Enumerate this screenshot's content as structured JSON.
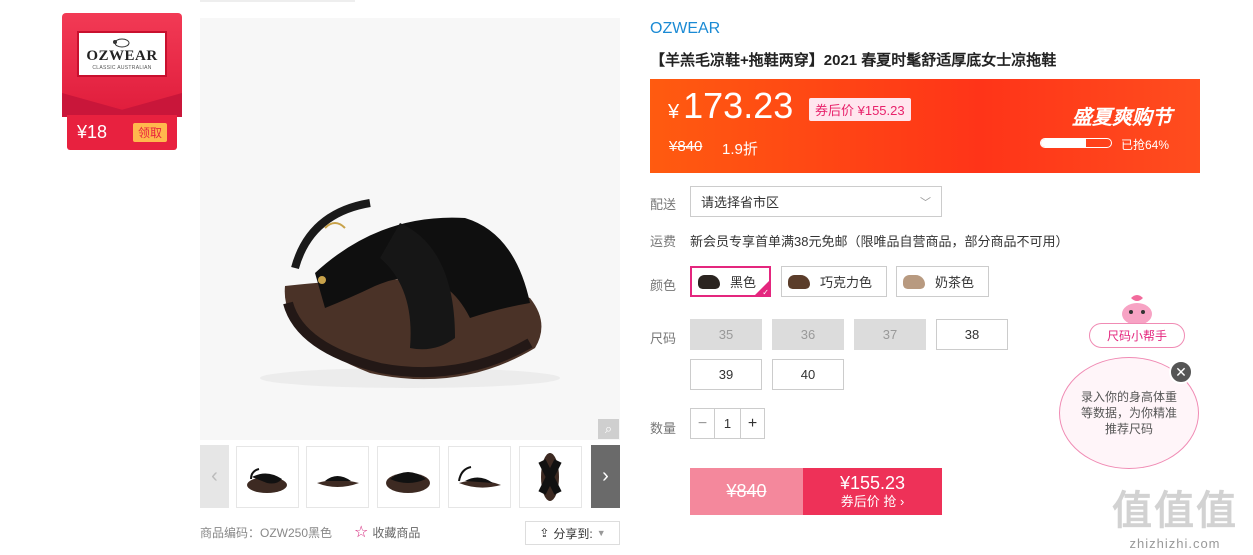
{
  "coupon": {
    "brand": "OZWEAR",
    "brand_sub": "CLASSIC AUSTRALIAN",
    "amount": "¥18",
    "claim": "领取"
  },
  "gallery": {
    "product_code_label": "商品编码：OZW250黑色",
    "favorite_label": "收藏商品",
    "share_label": "分享到:"
  },
  "product": {
    "brand": "OZWEAR",
    "title": "【羊羔毛凉鞋+拖鞋两穿】2021 春夏时髦舒适厚底女士凉拖鞋"
  },
  "price": {
    "yen": "¥",
    "current": "173.23",
    "after_coupon": "券后价 ¥155.23",
    "original": "¥840",
    "discount": "1.9折",
    "promo": "盛夏爽购节",
    "sold_percent": 64,
    "sold_label": "已抢64%"
  },
  "delivery": {
    "label": "配送",
    "placeholder": "请选择省市区"
  },
  "shipping": {
    "label": "运费",
    "text": "新会员专享首单满38元免邮（限唯品自营商品，部分商品不可用）"
  },
  "colors": {
    "label": "颜色",
    "options": [
      {
        "name": "黑色",
        "selected": true,
        "swatch": "#2b2420"
      },
      {
        "name": "巧克力色",
        "selected": false,
        "swatch": "#5b3d2a"
      },
      {
        "name": "奶茶色",
        "selected": false,
        "swatch": "#b89a80"
      }
    ]
  },
  "sizes": {
    "label": "尺码",
    "options": [
      {
        "value": "35",
        "available": false
      },
      {
        "value": "36",
        "available": false
      },
      {
        "value": "37",
        "available": false
      },
      {
        "value": "38",
        "available": true
      },
      {
        "value": "39",
        "available": true
      },
      {
        "value": "40",
        "available": true
      }
    ]
  },
  "quantity": {
    "label": "数量",
    "minus": "−",
    "value": "1",
    "plus": "+"
  },
  "buy": {
    "original": "¥840",
    "price": "¥155.23",
    "label": "券后价 抢 ›"
  },
  "helper": {
    "tag": "尺码小帮手",
    "bubble": "录入你的身高体重等数据，为你精准推荐尺码",
    "close": "✕"
  },
  "watermark": {
    "logo": "值值值",
    "url": "zhizhizhi.com"
  },
  "colors_theme": {
    "accent": "#e4267e",
    "price_bar": "#ff3418",
    "brand_link": "#1a8ad4"
  }
}
